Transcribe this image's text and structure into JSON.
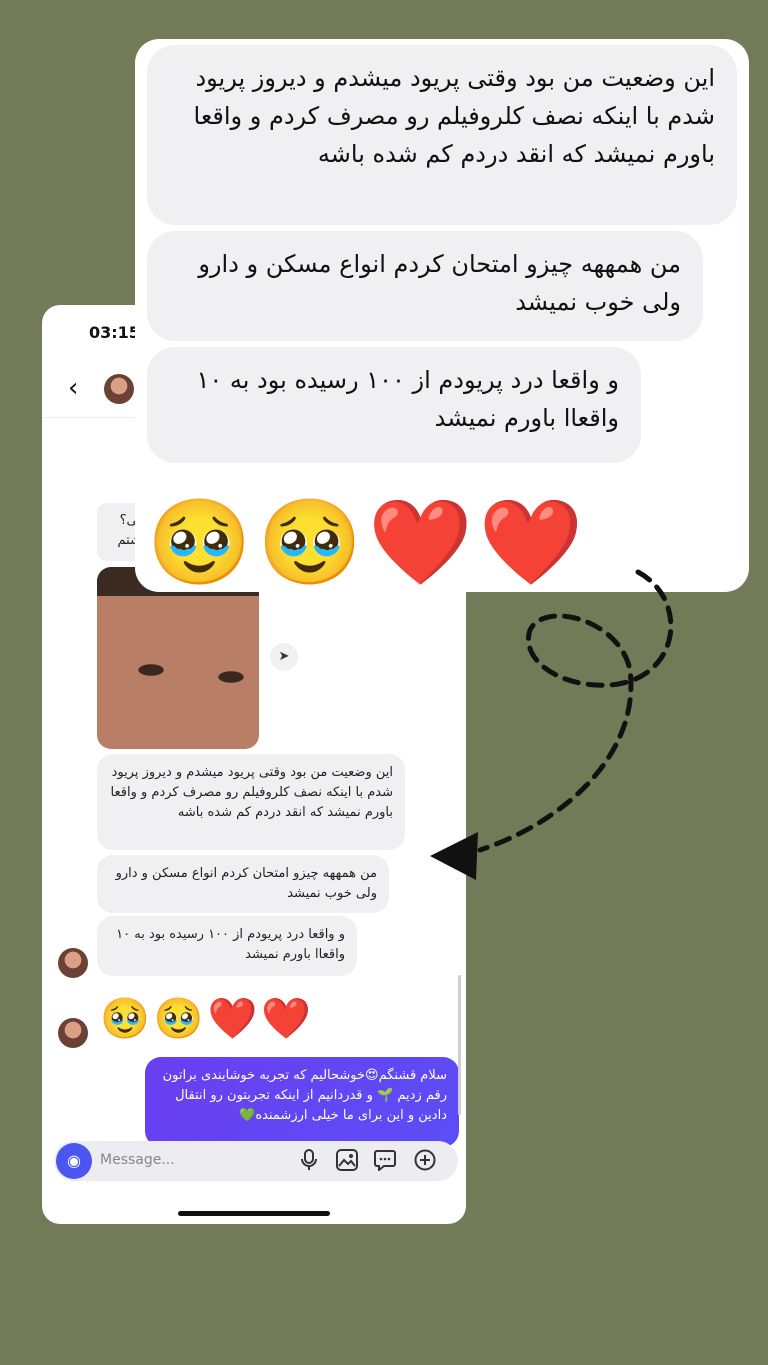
{
  "phone": {
    "status_time": "03:15",
    "partial_bubble": {
      "line1": "یی؟",
      "line2": "شتم"
    },
    "messages": [
      "این وضعیت من بود وقتی پریود میشدم و دیروز پریود شدم با اینکه نصف کلروفیلم رو مصرف کردم و واقعا باورم نمیشد که انقد دردم کم شده باشه",
      "من همههه چیزو امتحان کردم انواع مسکن و دارو ولی خوب نمیشد",
      "و واقعا درد پریودم از ۱۰۰ رسیده بود به ۱۰ واقعاا باورم نمیشد"
    ],
    "emoji_row": "🥹🥹❤️❤️",
    "outgoing_message": "سلام قشنگم😍خوشحالیم که تجربه خوشایندی براتون رقم زدیم 🌱 و قدردانیم از اینکه تجربتون رو انتقال دادین و این برای ما خیلی ارزشمنده💚",
    "composer": {
      "placeholder": "Message..."
    },
    "icons": {
      "back": "chevron-left-icon",
      "camera": "camera-icon",
      "mic": "mic-icon",
      "gallery": "image-icon",
      "sticker": "chat-bubble-icon",
      "add": "plus-circle-icon",
      "share": "send-icon"
    }
  },
  "zoom": {
    "messages": [
      "این وضعیت من بود وقتی پریود میشدم و دیروز پریود شدم با اینکه نصف کلروفیلم رو مصرف کردم و واقعا باورم نمیشد که انقد دردم کم شده باشه",
      "من همههه چیزو امتحان کردم انواع مسکن و دارو ولی خوب نمیشد",
      "و واقعا درد پریودم از ۱۰۰ رسیده بود به ۱۰ واقعاا باورم نمیشد"
    ],
    "emoji_row": "🥹🥹❤️❤️"
  },
  "colors": {
    "background": "#727b57",
    "outgoing_bubble": "#5b4ef6",
    "incoming_bubble": "#f0f0f3",
    "camera_button": "#4b55f0"
  }
}
